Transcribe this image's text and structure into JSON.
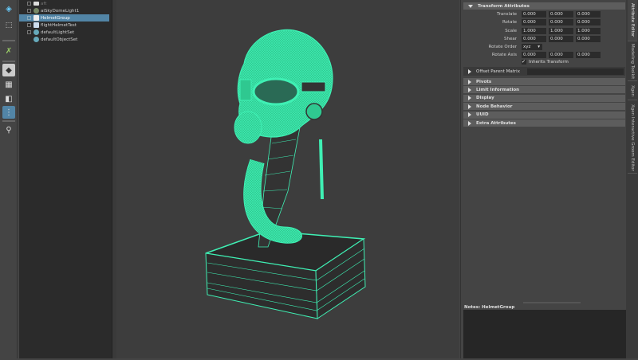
{
  "toolbar": {
    "tools": [
      "move-tool-icon",
      "lasso-icon",
      "scene-icon",
      "single-view-icon",
      "four-view-icon",
      "two-view-icon",
      "outliner-layout-icon",
      "search-icon"
    ]
  },
  "outliner": {
    "items": [
      {
        "label": "aft",
        "icon": "camera-icon",
        "expandable": true,
        "selected": false
      },
      {
        "label": "aiSkyDomeLight1",
        "icon": "skydome-icon",
        "expandable": true,
        "selected": false
      },
      {
        "label": "HelmetGroup",
        "icon": "group-icon",
        "expandable": true,
        "selected": true
      },
      {
        "label": "flightHelmetTest",
        "icon": "mesh-icon",
        "expandable": true,
        "selected": false
      },
      {
        "label": "defaultLightSet",
        "icon": "set-icon",
        "expandable": true,
        "selected": false
      },
      {
        "label": "defaultObjectSet",
        "icon": "set-icon",
        "expandable": false,
        "selected": false
      }
    ]
  },
  "viewport": {
    "wire_color": "#3ff0b4",
    "background": "#3d3d3d"
  },
  "attribute_editor": {
    "transform_header": "Transform Attributes",
    "rows": [
      {
        "label": "Translate",
        "values": [
          "0.000",
          "0.000",
          "0.000"
        ]
      },
      {
        "label": "Rotate",
        "values": [
          "0.000",
          "0.000",
          "0.000"
        ]
      },
      {
        "label": "Scale",
        "values": [
          "1.000",
          "1.000",
          "1.000"
        ]
      },
      {
        "label": "Shear",
        "values": [
          "0.000",
          "0.000",
          "0.000"
        ]
      }
    ],
    "rotate_order_label": "Rotate Order",
    "rotate_order_value": "xyz",
    "rotate_axis": {
      "label": "Rotate Axis",
      "values": [
        "0.000",
        "0.000",
        "0.000"
      ]
    },
    "inherits_transform": "Inherits Transform",
    "inherits_checked": true,
    "offset_parent_matrix": "Offset Parent Matrix",
    "sections": [
      "Pivots",
      "Limit Information",
      "Display",
      "Node Behavior",
      "UUID",
      "Extra Attributes"
    ],
    "notes_label": "Notes:  HelmetGroup"
  },
  "side_tabs": [
    "Attribute Editor",
    "Modeling Toolkit",
    "Xgen",
    "Xgen Interactive Groom Editor"
  ],
  "colors": {
    "selection": "#5285a6",
    "wire": "#3ff0b4"
  }
}
